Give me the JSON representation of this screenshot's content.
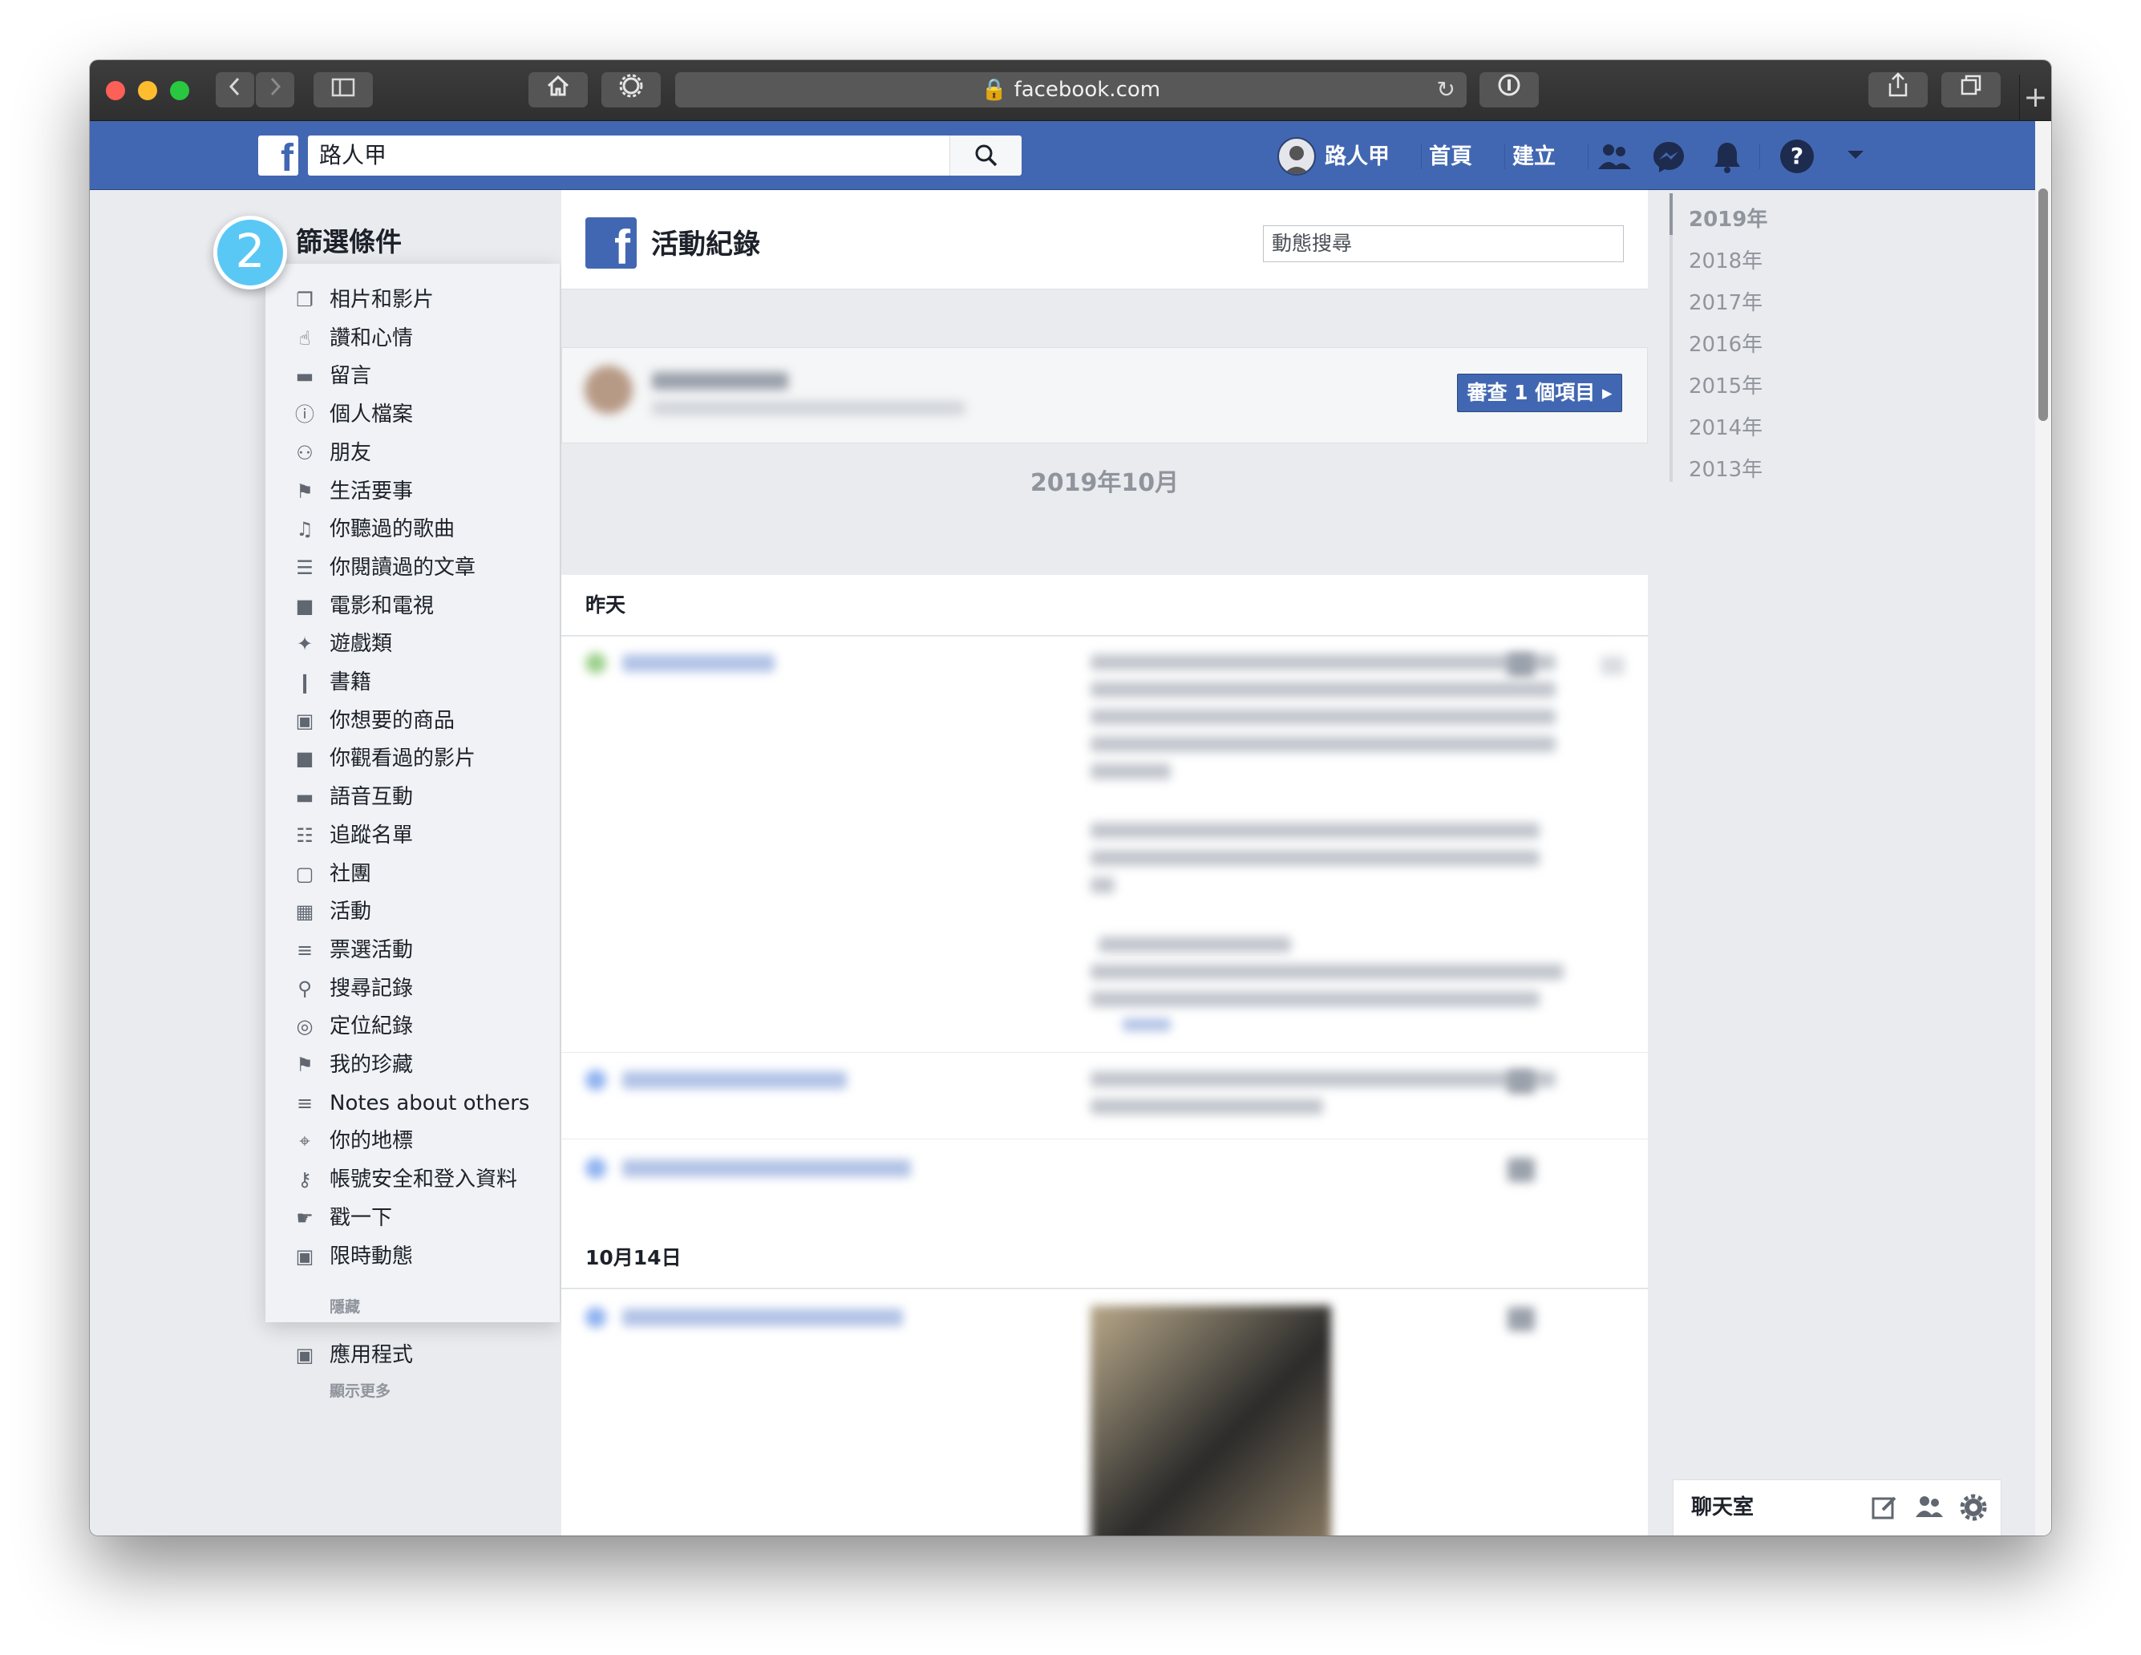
{
  "browser": {
    "url": "facebook.com"
  },
  "topbar": {
    "search_value": "路人甲",
    "profile_name": "路人甲",
    "home": "首頁",
    "create": "建立"
  },
  "filters": {
    "badge": "2",
    "title": "篩選條件",
    "items": [
      {
        "label": "相片和影片",
        "icon": "photos-icon"
      },
      {
        "label": "讚和心情",
        "icon": "like-icon"
      },
      {
        "label": "留言",
        "icon": "comment-icon"
      },
      {
        "label": "個人檔案",
        "icon": "info-icon"
      },
      {
        "label": "朋友",
        "icon": "friends-icon"
      },
      {
        "label": "生活要事",
        "icon": "flag-icon"
      },
      {
        "label": "你聽過的歌曲",
        "icon": "music-icon"
      },
      {
        "label": "你閱讀過的文章",
        "icon": "article-icon"
      },
      {
        "label": "電影和電視",
        "icon": "video-camera-icon"
      },
      {
        "label": "遊戲類",
        "icon": "game-icon"
      },
      {
        "label": "書籍",
        "icon": "book-icon"
      },
      {
        "label": "你想要的商品",
        "icon": "shopping-bag-icon"
      },
      {
        "label": "你觀看過的影片",
        "icon": "video-icon"
      },
      {
        "label": "語音互動",
        "icon": "voice-icon"
      },
      {
        "label": "追蹤名單",
        "icon": "rss-icon"
      },
      {
        "label": "社團",
        "icon": "groups-icon"
      },
      {
        "label": "活動",
        "icon": "calendar-icon"
      },
      {
        "label": "票選活動",
        "icon": "poll-icon"
      },
      {
        "label": "搜尋記錄",
        "icon": "search-history-icon"
      },
      {
        "label": "定位紀錄",
        "icon": "location-history-icon"
      },
      {
        "label": "我的珍藏",
        "icon": "bookmark-icon"
      },
      {
        "label": "Notes about others",
        "icon": "notes-icon"
      },
      {
        "label": "你的地標",
        "icon": "pin-icon"
      },
      {
        "label": "帳號安全和登入資料",
        "icon": "key-icon"
      },
      {
        "label": "戳一下",
        "icon": "poke-icon"
      },
      {
        "label": "限時動態",
        "icon": "stories-icon"
      }
    ],
    "hidden_label": "隱藏",
    "apps_label": "應用程式",
    "show_more": "顯示更多"
  },
  "activity_log": {
    "title": "活動紀錄",
    "search_placeholder": "動態搜尋",
    "review_button": "審查 1 個項目",
    "month_heading": "2019年10月",
    "day_yesterday": "昨天",
    "day_oct14": "10月14日"
  },
  "years": [
    "2019年",
    "2018年",
    "2017年",
    "2016年",
    "2015年",
    "2014年",
    "2013年"
  ],
  "chat": {
    "title": "聊天室"
  },
  "colors": {
    "facebook_blue": "#4267b2",
    "badge_blue": "#5ac8f5"
  }
}
